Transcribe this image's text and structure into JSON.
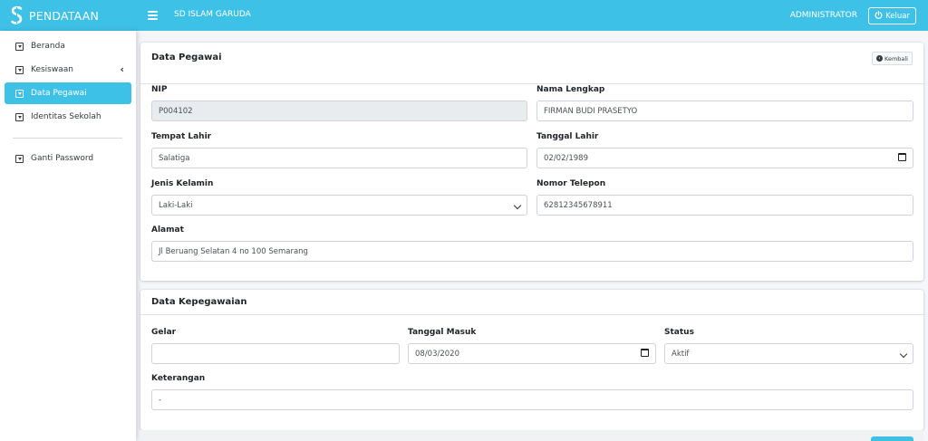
{
  "brand": {
    "name": "PENDATAAN",
    "logo_icon": "s-logo-icon"
  },
  "topbar": {
    "school": "SD ISLAM GARUDA",
    "user": "ADMINISTRATOR",
    "logout_label": "Keluar"
  },
  "sidebar": {
    "items": [
      {
        "label": "Beranda"
      },
      {
        "label": "Kesiswaan"
      },
      {
        "label": "Data Pegawai"
      },
      {
        "label": "Identitas Sekolah"
      },
      {
        "label": "Ganti Password"
      }
    ]
  },
  "pegawai": {
    "title": "Data Pegawai",
    "back_label": "Kembali",
    "nip_label": "NIP",
    "nip_value": "P004102",
    "nama_label": "Nama Lengkap",
    "nama_value": "FIRMAN BUDI PRASETYO",
    "tempat_label": "Tempat Lahir",
    "tempat_value": "Salatiga",
    "tanggal_label": "Tanggal Lahir",
    "tanggal_value": "02/02/1989",
    "jk_label": "Jenis Kelamin",
    "jk_value": "Laki-Laki",
    "telp_label": "Nomor Telepon",
    "telp_value": "62812345678911",
    "alamat_label": "Alamat",
    "alamat_value": "Jl Beruang Selatan 4 no 100 Semarang"
  },
  "kepegawaian": {
    "title": "Data Kepegawaian",
    "gelar_label": "Gelar",
    "gelar_value": "",
    "masuk_label": "Tanggal Masuk",
    "masuk_value": "08/03/2020",
    "status_label": "Status",
    "status_value": "Aktif",
    "ket_label": "Keterangan",
    "ket_value": "-"
  },
  "colors": {
    "primary": "#3ec1e6",
    "background": "#f4f6f9"
  }
}
